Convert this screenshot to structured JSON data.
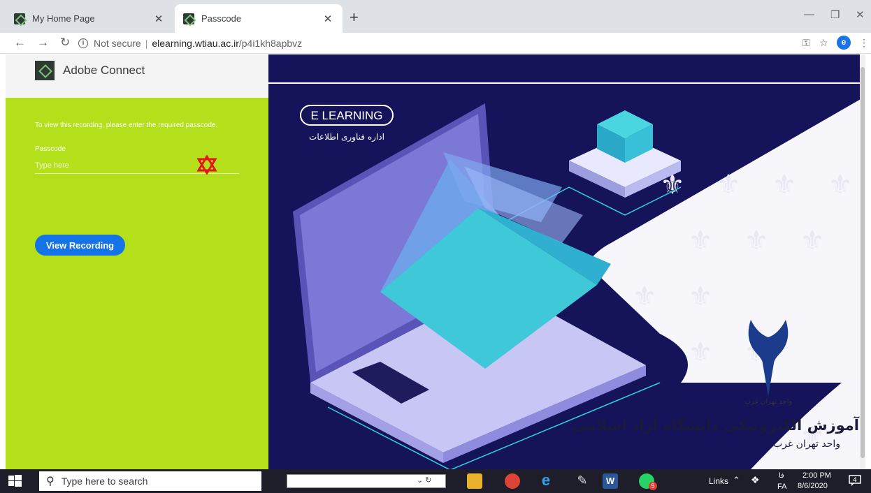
{
  "browser": {
    "tabs": [
      {
        "title": "My Home Page",
        "active": false
      },
      {
        "title": "Passcode",
        "active": true
      }
    ],
    "address": {
      "security": "Not secure",
      "host": "elearning.wtiau.ac.ir",
      "path": "/p4i1kh8apbvz"
    },
    "profile_initial": "e",
    "icons": [
      "back-arrow-icon",
      "forward-arrow-icon",
      "reload-icon",
      "info-icon",
      "key-icon",
      "star-icon",
      "menu-dots-icon"
    ]
  },
  "app": {
    "brand": "Adobe Connect",
    "prompt": "To view this recording, please enter the required passcode.",
    "passcode_label": "Passcode",
    "passcode_placeholder": "Type here",
    "view_button": "View Recording",
    "accent_color": "#b3e01a",
    "button_color": "#1473e6"
  },
  "banner": {
    "badge": "E LEARNING",
    "badge_subtitle": "اداره فناوری اطلاعات",
    "title": "آموزش الکترونیکی دانشگاه آزاد اسلامی",
    "subtitle": "واحد تهران غرب",
    "emblem_caption": "واحد تهران غرب"
  },
  "taskbar": {
    "search_placeholder": "Type here to search",
    "links_label": "Links",
    "lang_top": "فا",
    "lang": "FA",
    "time": "2:00 PM",
    "date": "8/6/2020",
    "whatsapp_badge": "5",
    "notification_count": "4"
  }
}
